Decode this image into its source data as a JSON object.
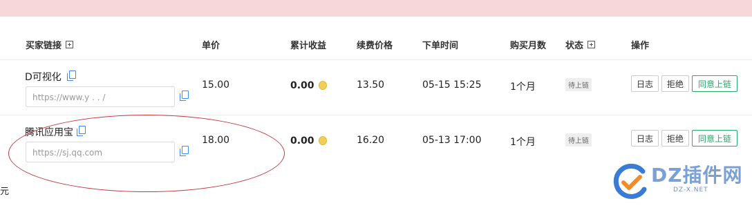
{
  "header": {
    "link": "买家链接",
    "unit_price": "单价",
    "total_income": "累计收益",
    "renew_price": "续费价格",
    "order_time": "下单时间",
    "months": "购买月数",
    "status": "状态",
    "actions": "操作"
  },
  "rows": [
    {
      "name": "D可视化",
      "url": "https://www.y    .    .     /",
      "unit_price": "15.00",
      "income": "0.00",
      "renew": "13.50",
      "time": "05-15 15:25",
      "months": "1个月",
      "status": "待上链",
      "btn_log": "日志",
      "btn_reject": "拒绝",
      "btn_agree": "同意上链"
    },
    {
      "name": "腾讯应用宝",
      "url": "https://sj.qq.com",
      "unit_price": "18.00",
      "income": "0.00",
      "renew": "16.20",
      "time": "05-13 17:00",
      "months": "1个月",
      "status": "待上链",
      "btn_log": "日志",
      "btn_reject": "拒绝",
      "btn_agree": "同意上链"
    }
  ],
  "side_char": "元",
  "watermark": {
    "text": "DZ插件网",
    "sub": "DZ-X.NET"
  }
}
